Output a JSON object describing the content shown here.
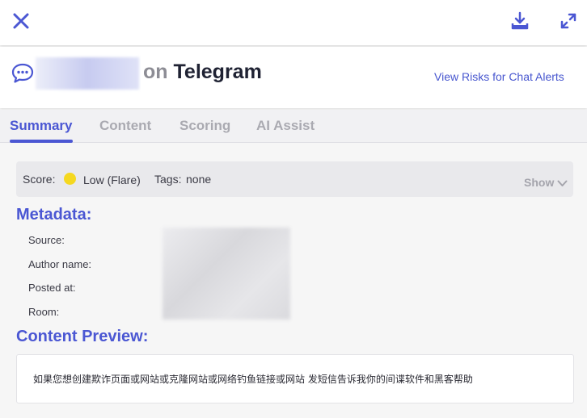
{
  "header": {
    "title_on": "on",
    "title_platform": "Telegram",
    "view_risks_label": "View Risks for Chat Alerts"
  },
  "tabs": [
    {
      "label": "Summary",
      "active": true
    },
    {
      "label": "Content",
      "active": false
    },
    {
      "label": "Scoring",
      "active": false
    },
    {
      "label": "AI Assist",
      "active": false
    }
  ],
  "score": {
    "label": "Score:",
    "value": "Low (Flare)",
    "dot_color": "#f5d820",
    "tags_label": "Tags:",
    "tags_value": "none",
    "show_label": "Show"
  },
  "metadata": {
    "title": "Metadata:",
    "fields": [
      {
        "label": "Source:"
      },
      {
        "label": "Author name:"
      },
      {
        "label": "Posted at:"
      },
      {
        "label": "Room:"
      }
    ]
  },
  "content_preview": {
    "title": "Content Preview:",
    "text": "如果您想创建欺诈页面或网站或克隆网站或网络钓鱼链接或网站  发短信告诉我你的间谍软件和黑客帮助"
  },
  "colors": {
    "accent": "#4b57d3",
    "score_low": "#f5d820"
  },
  "icons": [
    "close-icon",
    "download-icon",
    "expand-icon",
    "chat-bubble-icon",
    "chevron-down-icon"
  ]
}
